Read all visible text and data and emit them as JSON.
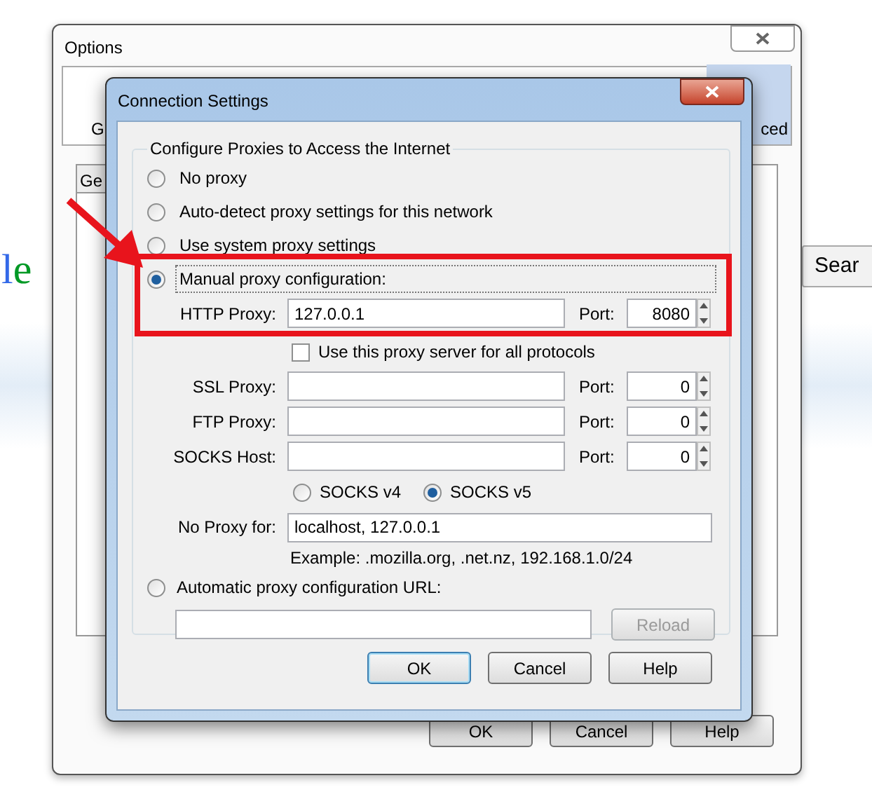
{
  "background": {
    "logo_fragment": "le",
    "search_button": "Sear"
  },
  "options_window": {
    "title": "Options",
    "tabs": [
      {
        "label": "G",
        "selected": false
      },
      {
        "label": "ced",
        "selected": true
      }
    ],
    "inner_tab": "Ge",
    "buttons": [
      "OK",
      "Cancel",
      "Help"
    ]
  },
  "dialog": {
    "title": "Connection Settings",
    "group_title": "Configure Proxies to Access the Internet",
    "modes": [
      {
        "label": "No proxy",
        "selected": false
      },
      {
        "label": "Auto-detect proxy settings for this network",
        "selected": false
      },
      {
        "label": "Use system proxy settings",
        "selected": false
      },
      {
        "label": "Manual proxy configuration:",
        "selected": true
      }
    ],
    "proxies": [
      {
        "label": "HTTP Proxy:",
        "value": "127.0.0.1",
        "port_label": "Port:",
        "port": "8080"
      },
      {
        "label": "SSL Proxy:",
        "port_label": "Port:",
        "port": "0"
      },
      {
        "label": "FTP Proxy:",
        "port_label": "Port:",
        "port": "0"
      },
      {
        "label": "SOCKS Host:",
        "port_label": "Port:",
        "port": "0"
      }
    ],
    "share_all": {
      "label": "Use this proxy server for all protocols",
      "checked": false
    },
    "socks_versions": [
      {
        "label": "SOCKS v4",
        "selected": false
      },
      {
        "label": "SOCKS v5",
        "selected": true
      }
    ],
    "no_proxy": {
      "label": "No Proxy for:",
      "value": "localhost, 127.0.0.1"
    },
    "example": "Example: .mozilla.org, .net.nz, 192.168.1.0/24",
    "auto_url": {
      "label": "Automatic proxy configuration URL:",
      "selected": false
    },
    "reload": {
      "label": "Reload",
      "disabled": true
    },
    "buttons": [
      {
        "label": "OK",
        "default": true
      },
      {
        "label": "Cancel",
        "default": false
      },
      {
        "label": "Help",
        "default": false
      }
    ]
  }
}
